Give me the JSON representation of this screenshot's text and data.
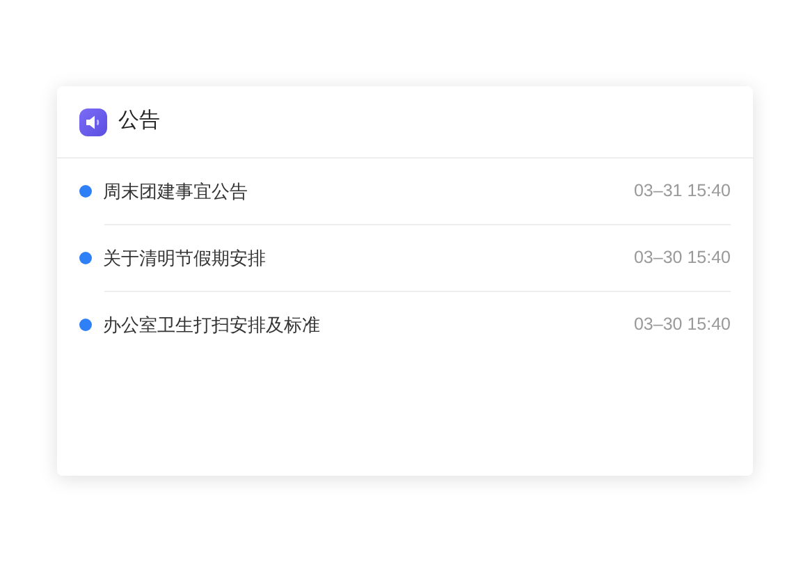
{
  "card": {
    "title": "公告"
  },
  "notices": [
    {
      "title": "周末团建事宜公告",
      "time": "03–31 15:40"
    },
    {
      "title": "关于清明节假期安排",
      "time": "03–30 15:40"
    },
    {
      "title": "办公室卫生打扫安排及标准",
      "time": "03–30 15:40"
    }
  ]
}
